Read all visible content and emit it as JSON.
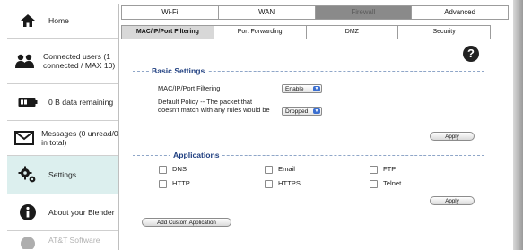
{
  "sidebar": {
    "items": [
      {
        "label": "Home",
        "icon": "home-icon"
      },
      {
        "label": "Connected users (1 connected / MAX 10)",
        "icon": "users-icon"
      },
      {
        "label": "0 B  data remaining",
        "icon": "battery-icon"
      },
      {
        "label": "Messages (0 unread/0 in total)",
        "icon": "envelope-icon"
      },
      {
        "label": "Settings",
        "icon": "gears-icon",
        "active": true
      },
      {
        "label": "About your Blender",
        "icon": "info-icon"
      },
      {
        "label": "AT&T Software",
        "icon": "software-icon"
      }
    ]
  },
  "tabs": [
    "Wi-Fi",
    "WAN",
    "Firewall",
    "Advanced"
  ],
  "active_tab": "Firewall",
  "subtabs": [
    "MAC/IP/Port Filtering",
    "Port Forwarding",
    "DMZ",
    "Security"
  ],
  "active_subtab": "MAC/IP/Port Filtering",
  "basic": {
    "title": "Basic Settings",
    "filter_label": "MAC/IP/Port Filtering",
    "filter_value": "Enable",
    "policy_label": "Default Policy -- The packet that doesn't match with any rules would be",
    "policy_value": "Dropped",
    "apply": "Apply"
  },
  "apps": {
    "title": "Applications",
    "items": [
      "DNS",
      "Email",
      "FTP",
      "HTTP",
      "HTTPS",
      "Telnet"
    ],
    "apply": "Apply",
    "add_custom": "Add Custom Application"
  },
  "colors": {
    "active_sidebar": "#dcefee",
    "legend": "#1f3f80",
    "active_tab": "#8a8a8a"
  }
}
